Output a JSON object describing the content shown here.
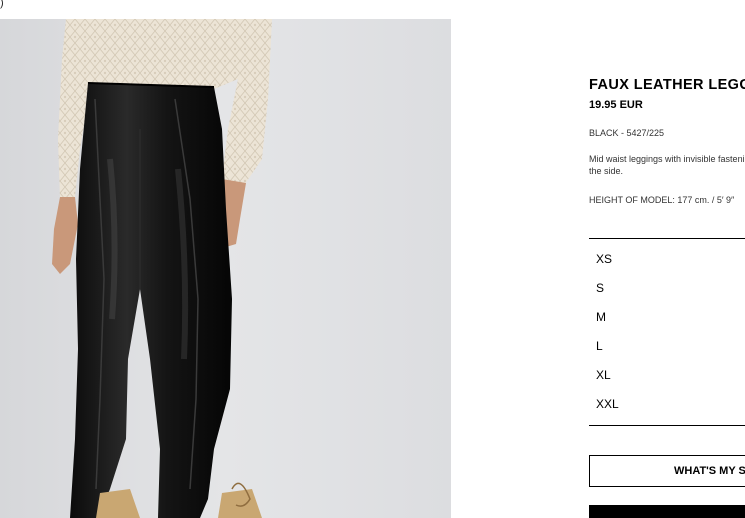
{
  "corner": {
    "glyph": ")"
  },
  "product": {
    "title": "FAUX LEATHER LEGGINGS",
    "price": "19.95 EUR",
    "color_ref": "BLACK - 5427/225",
    "description": "Mid waist leggings with invisible fastening at the side.",
    "model_height": "HEIGHT OF MODEL: 177 cm. / 5′ 9″"
  },
  "sizes": [
    "XS",
    "S",
    "M",
    "L",
    "XL",
    "XXL"
  ],
  "buttons": {
    "size_guide": "WHAT'S MY SIZE?",
    "add_to_basket": ""
  },
  "colors": {
    "photo_background": "#e1e2e4",
    "leggings": "#121212",
    "sweater": "#ece4d6",
    "skin": "#c9987a",
    "boot": "#c9a772"
  }
}
